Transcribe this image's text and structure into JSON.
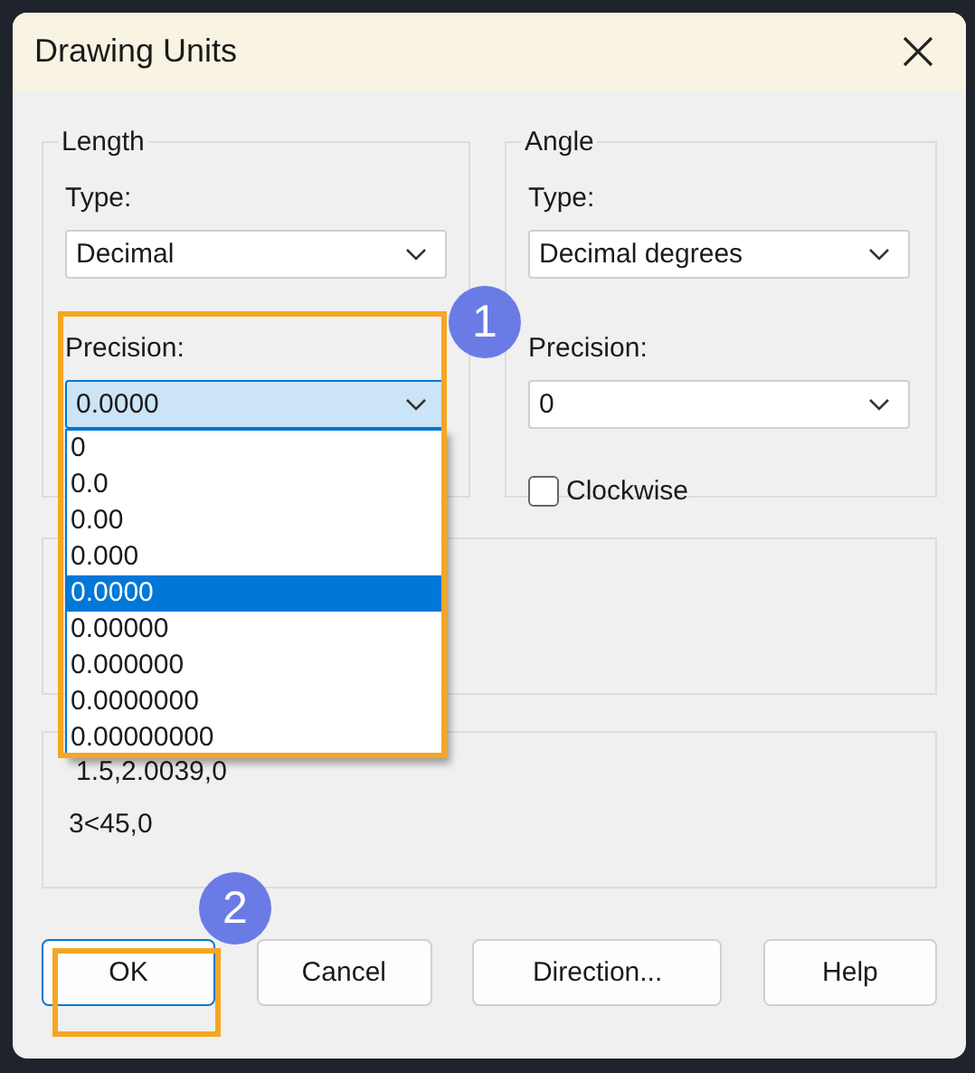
{
  "window": {
    "title": "Drawing Units"
  },
  "length": {
    "title": "Length",
    "type_label": "Type:",
    "type_value": "Decimal",
    "precision_label": "Precision:",
    "precision_value": "0.0000",
    "precision_expanded": true,
    "precision_options": [
      {
        "label": "0",
        "selected": false
      },
      {
        "label": "0.0",
        "selected": false
      },
      {
        "label": "0.00",
        "selected": false
      },
      {
        "label": "0.000",
        "selected": false
      },
      {
        "label": "0.0000",
        "selected": true
      },
      {
        "label": "0.00000",
        "selected": false
      },
      {
        "label": "0.000000",
        "selected": false
      },
      {
        "label": "0.0000000",
        "selected": false
      },
      {
        "label": "0.00000000",
        "selected": false
      }
    ]
  },
  "angle": {
    "title": "Angle",
    "type_label": "Type:",
    "type_value": "Decimal degrees",
    "precision_label": "Precision:",
    "precision_value": "0",
    "clockwise": {
      "label": "Clockwise",
      "checked": false
    }
  },
  "sample_output": [
    "1.5,2.0039,0",
    "3<45,0"
  ],
  "buttons": [
    {
      "label": "OK",
      "default": true
    },
    {
      "label": "Cancel",
      "default": false
    },
    {
      "label": "Direction...",
      "default": false
    },
    {
      "label": "Help",
      "default": false
    }
  ],
  "callouts": [
    {
      "number": "1"
    },
    {
      "number": "2"
    }
  ]
}
